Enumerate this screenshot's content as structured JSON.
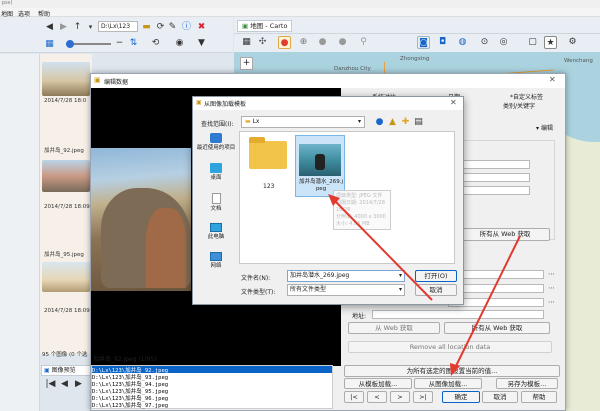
{
  "app": {
    "title_partial": "psıı)",
    "menu": [
      "地图",
      "选项",
      "帮助"
    ]
  },
  "toolbar": {
    "path_value": "D:\\Lx\\123",
    "map_tab_label": "地图 - Carto"
  },
  "map": {
    "labels": [
      {
        "text": "Danzhou City"
      },
      {
        "text": "Zhongxing"
      },
      {
        "text": "Wenchang"
      }
    ]
  },
  "thumbnails": [
    {
      "time": "2014/7/28 18:0"
    },
    {
      "name": "加井岛_92.jpeg"
    },
    {
      "time": "2014/7/28 18:09:4"
    },
    {
      "name": "加井岛_95.jpeg"
    },
    {
      "time": "2014/7/28 18:09:4"
    }
  ],
  "status": {
    "count": "95 个图像 (0 个选",
    "preview_tab": "图像预览"
  },
  "file_list": [
    "D:\\Lx\\123\\加井岛_92.jpeg",
    "D:\\Lx\\123\\加井岛_93.jpeg",
    "D:\\Lx\\123\\加井岛_94.jpeg",
    "D:\\Lx\\123\\加井岛_95.jpeg",
    "D:\\Lx\\123\\加井岛_96.jpeg",
    "D:\\Lx\\123\\加井岛_97.jpeg"
  ],
  "edit_window": {
    "title": "编辑数据",
    "caption": "加井岛_92.jpeg (1/95)",
    "tabs": [
      "系统对比",
      "日期",
      "*自定义标签",
      "类别/关键字"
    ],
    "edit_label": "编辑",
    "ctrl_label": "制",
    "web_get_btn1": "所有从 Web 获取",
    "address_label": "地址:",
    "web_get_single": "从 Web 获取",
    "web_get_btn2": "所有从 Web 获取",
    "remove_all": "Remove all location data",
    "apply_all_partial": "为所有选定的图设置当前的值...",
    "load_from_template": "从模板加载...",
    "load_from_image": "从图像加载...",
    "save_as_template": "另存为模板...",
    "ok": "确定",
    "cancel": "取消",
    "help": "帮助"
  },
  "dialog": {
    "title": "从图像加载模板",
    "look_in_label": "查找范围(I):",
    "look_in_value": "Lx",
    "places": [
      "最近使用的项目",
      "桌面",
      "文档",
      "此电脑",
      "网络"
    ],
    "items": [
      {
        "name": "123"
      },
      {
        "name": "加井岛潜水_269.jpeg"
      }
    ],
    "tooltip": [
      "项目类型: JPEG 文件",
      "拍摄日期: 2014/7/28 16:26",
      "分辨率: 4000 x 3000",
      "大小: 4.05 MB"
    ],
    "filename_label": "文件名(N):",
    "filename_value": "加井岛潜水_269.jpeg",
    "filetype_label": "文件类型(T):",
    "filetype_value": "所有文件类型",
    "open_btn": "打开(O)",
    "cancel_btn": "取消"
  },
  "colors": {
    "accent_blue": "#0a64c8",
    "arrow_red": "#e23a2e",
    "folder_yellow": "#f3c44a",
    "map_water": "#aad3df",
    "map_land": "#e8ecd6"
  }
}
